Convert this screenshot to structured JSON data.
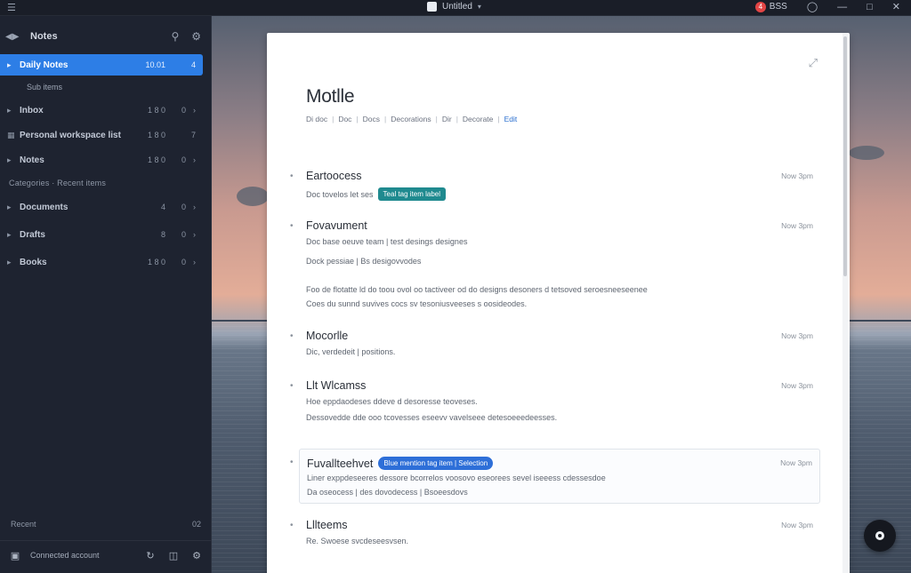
{
  "topbar": {
    "menu_icon": "menu-icon",
    "doc_title": "Untitled",
    "user_badge": "4",
    "user_name": "BSS"
  },
  "sidebar": {
    "title": "Notes",
    "items": [
      {
        "label": "Daily Notes",
        "count": "10.01",
        "meta": "4"
      },
      {
        "label": "Sub items",
        "count": "",
        "meta": ""
      },
      {
        "label": "Inbox",
        "count": "1 8 0",
        "meta": "0"
      },
      {
        "label": "Personal workspace list",
        "count": "1 8 0",
        "meta": "7"
      },
      {
        "label": "Notes",
        "count": "1 8 0",
        "meta": "0"
      }
    ],
    "section_label": "Categories · Recent items",
    "section_items": [
      {
        "label": "Documents",
        "count": "4",
        "meta": "0"
      },
      {
        "label": "Drafts",
        "count": "8",
        "meta": "0"
      },
      {
        "label": "Books",
        "count": "1 8 0",
        "meta": "0"
      }
    ],
    "footer_label": "Recent",
    "footer_count": "02",
    "footer_text": "Connected account"
  },
  "document": {
    "title": "Motlle",
    "tags": [
      "Di doc",
      "Doc",
      "Docs",
      "Decorations",
      "Dir",
      "Decorate"
    ],
    "tag_link": "Edit",
    "entries": [
      {
        "title": "Eartoocess",
        "time": "Now 3pm",
        "lines": [
          "Doc tovelos let ses"
        ],
        "chip": "Teal tag item label",
        "chip_style": "teal"
      },
      {
        "title": "Fovavument",
        "time": "Now 3pm",
        "lines": [
          "Doc base oeuve team | test desings designes",
          "Dock pessiae | Bs desigovvodes",
          "Foo de flotatte ld do toou ovol oo tactiveer od do designs desoners d tetsoved seroesneeseenee",
          "Coes du sunnd suvives cocs sv tesoniusveeses s oosideodes."
        ],
        "chip": "",
        "chip_style": ""
      },
      {
        "title": "Mocorlle",
        "time": "Now 3pm",
        "lines": [
          "Dic, verdedeit | positions."
        ],
        "chip": "",
        "chip_style": ""
      },
      {
        "title": "Llt Wlcamss",
        "time": "Now 3pm",
        "lines": [
          "Hoe eppdaodeses ddeve d desoresse teoveses.",
          "Dessovedde dde ooo tcovesses eseevv vavelseee detesoeeedeesses."
        ],
        "chip": "",
        "chip_style": ""
      },
      {
        "title": "Fuvallteehvet",
        "time": "Now 3pm",
        "lines": [
          "Liner exppdeseeres dessore bcorrelos voosovo eseorees sevel iseeess cdessesdoe",
          "Da oseocess | des dovodecess | Bsoeesdovs"
        ],
        "chip": "Blue mention tag item | Selection",
        "chip_style": "blue"
      },
      {
        "title": "Lllteems",
        "time": "Now 3pm",
        "lines": [
          "Re. Swoese svcdeseesvsen."
        ],
        "chip": "",
        "chip_style": ""
      }
    ]
  },
  "fab": {
    "icon": "record-icon"
  },
  "colors": {
    "accent": "#2d7ee6",
    "teal": "#1f8a8f",
    "sidebar": "#1e2330"
  }
}
